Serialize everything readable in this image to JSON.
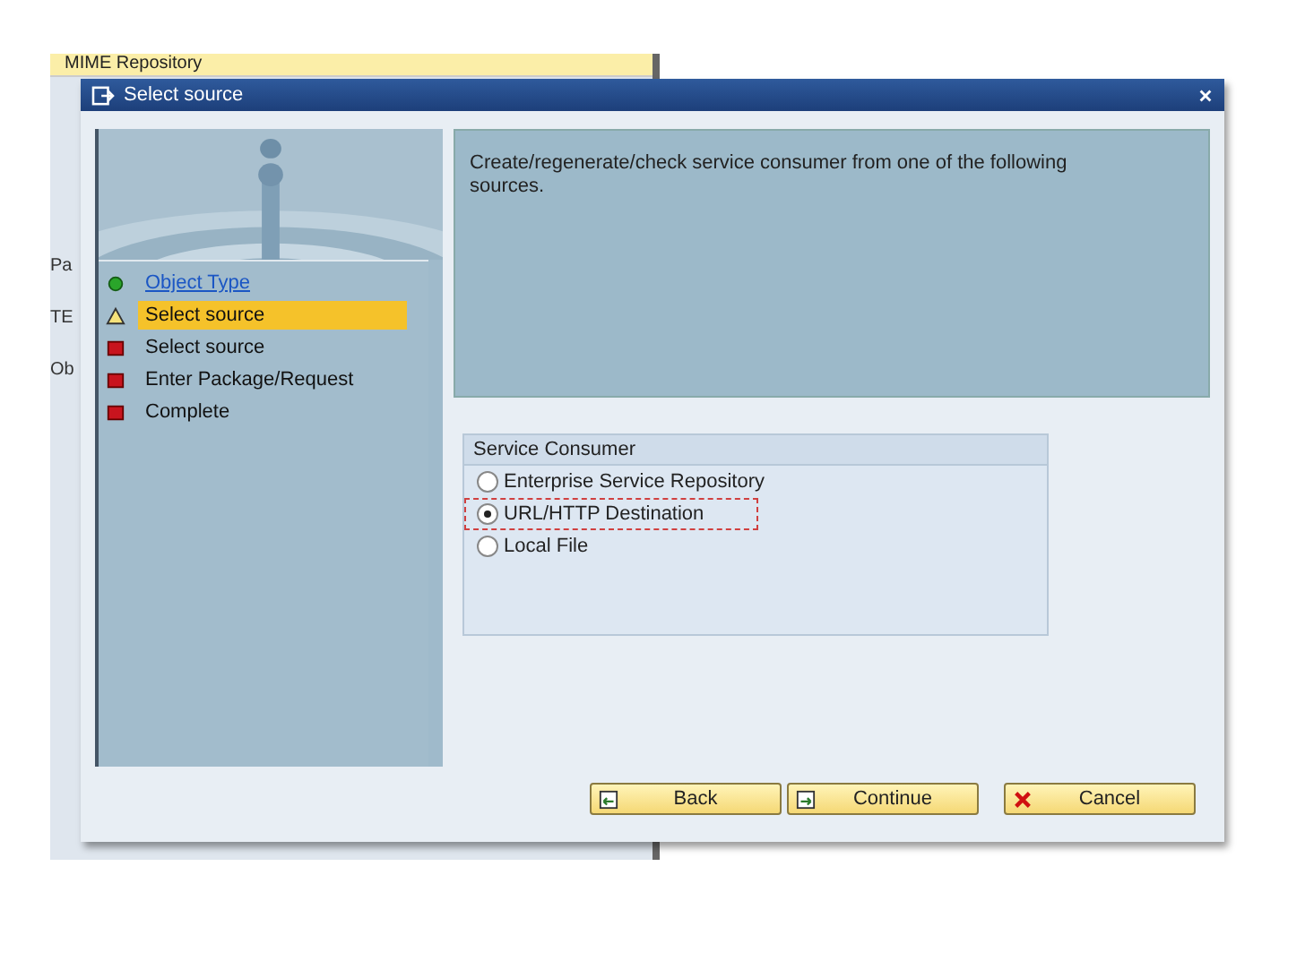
{
  "background_window": {
    "title": "MIME Repository",
    "fragments": [
      "Pa",
      "TE",
      "Ob"
    ]
  },
  "dialog": {
    "title": "Select source"
  },
  "steps": [
    {
      "label": "Object Type",
      "kind": "done",
      "selected": false
    },
    {
      "label": "Select source",
      "kind": "current",
      "selected": true
    },
    {
      "label": "Select source",
      "kind": "pending",
      "selected": false
    },
    {
      "label": "Enter Package/Request",
      "kind": "pending",
      "selected": false
    },
    {
      "label": "Complete",
      "kind": "pending",
      "selected": false
    }
  ],
  "description": "Create/regenerate/check service consumer from one of the following sources.",
  "group": {
    "title": "Service Consumer",
    "options": [
      {
        "label": "Enterprise Service Repository",
        "selected": false
      },
      {
        "label": "URL/HTTP Destination",
        "selected": true
      },
      {
        "label": "Local File",
        "selected": false
      }
    ]
  },
  "buttons": [
    {
      "label": "Back",
      "kind": "back"
    },
    {
      "label": "Continue",
      "kind": "continue"
    },
    {
      "label": "Cancel",
      "kind": "cancel"
    }
  ]
}
